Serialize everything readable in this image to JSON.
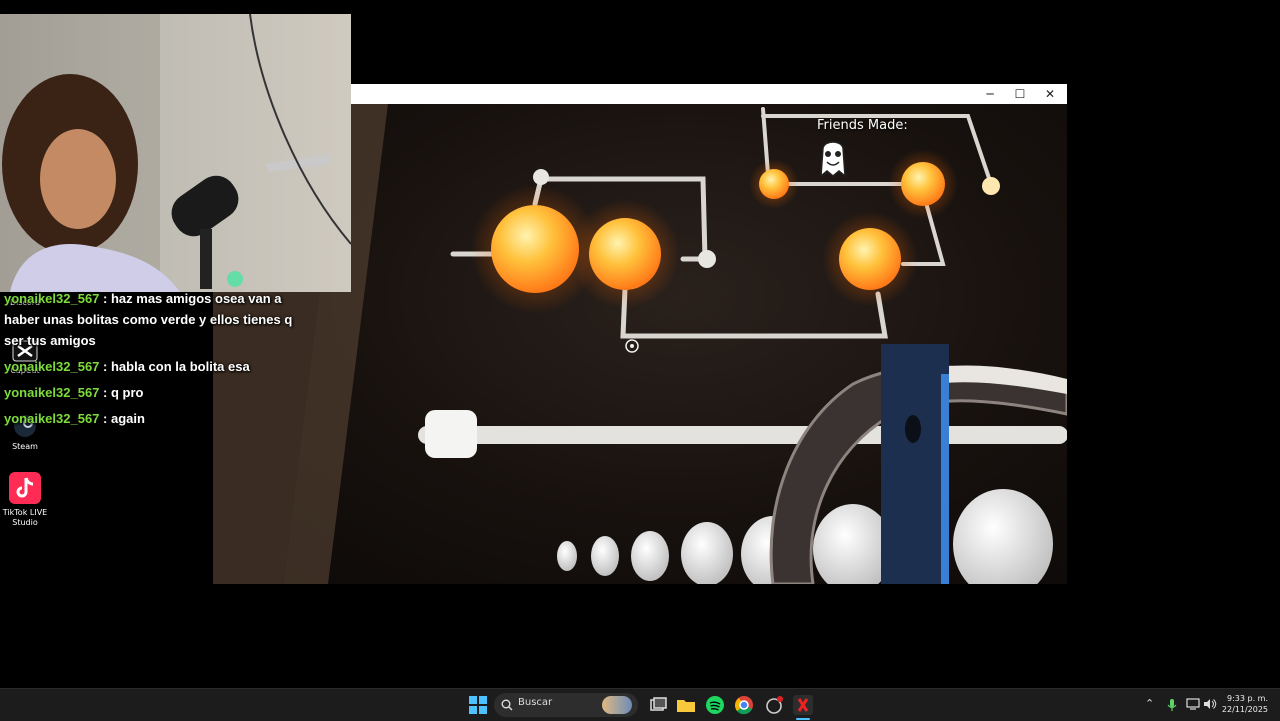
{
  "desktop": {
    "icons": [
      {
        "label": "Discord"
      },
      {
        "label": "CapCut"
      },
      {
        "label": "Steam"
      },
      {
        "label": "TikTok LIVE Studio"
      }
    ]
  },
  "game": {
    "hud": {
      "friends_label": "Friends Made:"
    },
    "window_controls": {
      "minimize": "─",
      "maximize": "☐",
      "close": "✕"
    }
  },
  "chat": {
    "messages": [
      {
        "user": "yonaikel32_567",
        "text": ": haz mas amigos osea van a haber unas bolitas como verde y ellos tienes q ser tus amigos"
      },
      {
        "user": "yonaikel32_567",
        "text": ": habla con la bolita esa"
      },
      {
        "user": "yonaikel32_567",
        "text": ": q pro"
      },
      {
        "user": "yonaikel32_567",
        "text": ": again"
      }
    ]
  },
  "taskbar": {
    "search_placeholder": "Buscar",
    "clock_time": "9:33 p. m.",
    "clock_date": "22/11/2025"
  },
  "colors": {
    "chat_user": "#7ddc3c",
    "orb": "#ffb733",
    "taskbar": "#1c1c1c"
  }
}
